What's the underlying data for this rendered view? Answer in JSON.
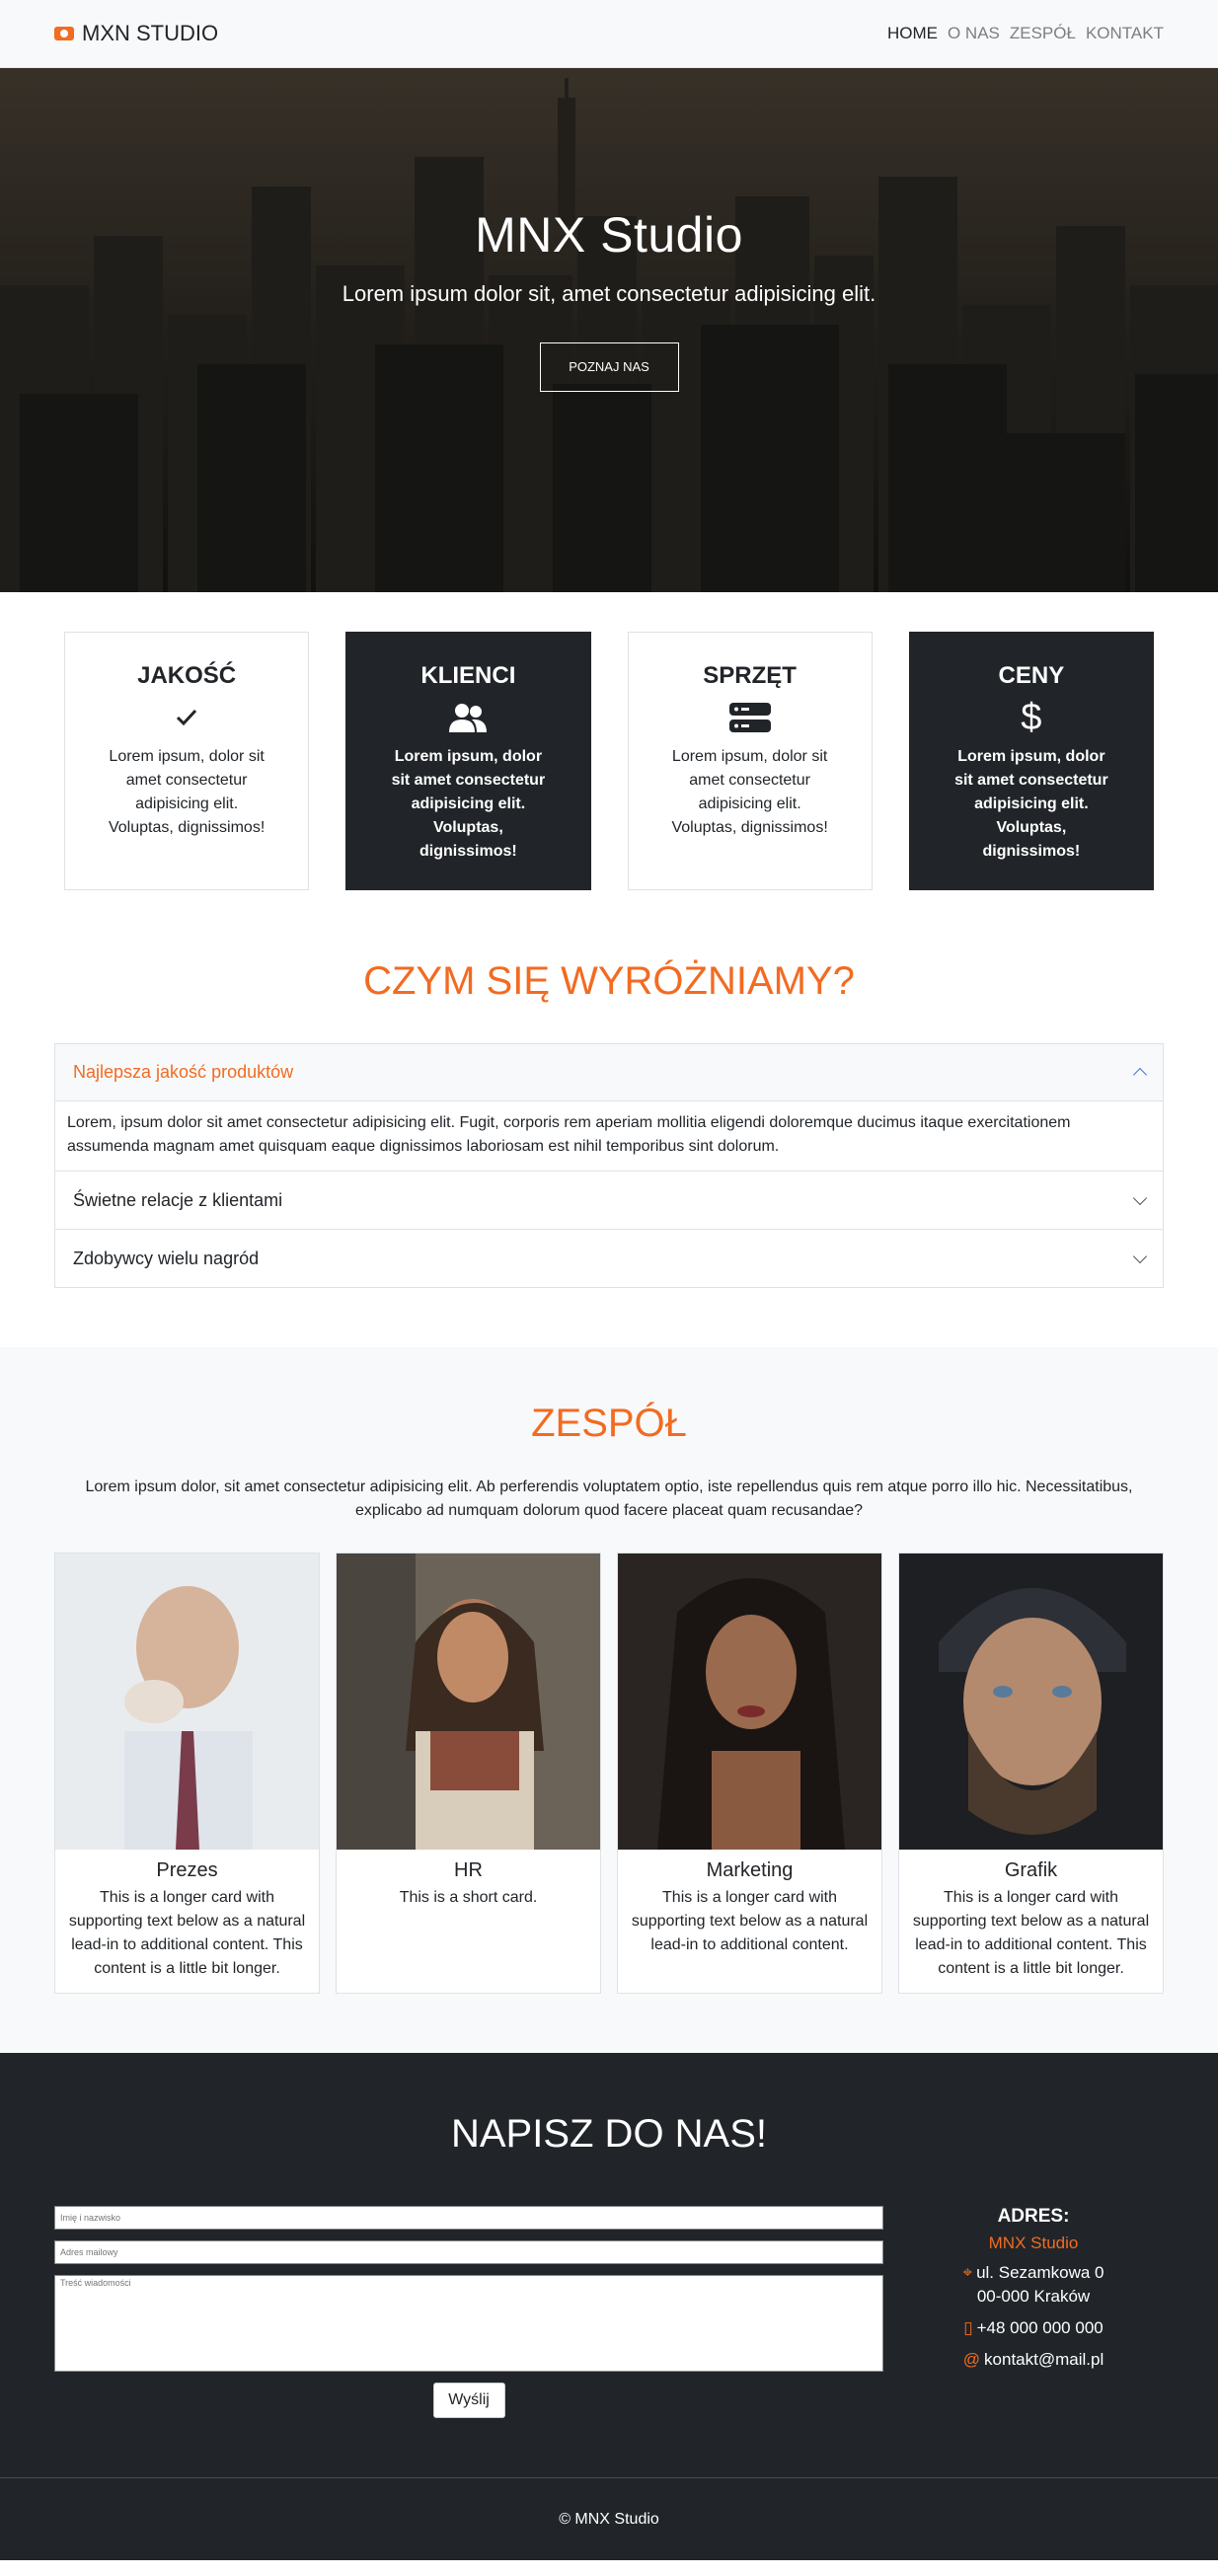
{
  "navbar": {
    "brand": "MXN STUDIO",
    "links": [
      "HOME",
      "O NAS",
      "ZESPÓŁ",
      "KONTAKT"
    ]
  },
  "hero": {
    "title": "MNX Studio",
    "subtitle": "Lorem ipsum dolor sit, amet consectetur adipisicing elit.",
    "button": "POZNAJ NAS"
  },
  "features": [
    {
      "title": "JAKOŚĆ",
      "icon": "check-icon",
      "text": "Lorem ipsum, dolor sit amet consectetur adipisicing elit. Voluptas, dignissimos!"
    },
    {
      "title": "KLIENCI",
      "icon": "users-icon",
      "text": "Lorem ipsum, dolor sit amet consectetur adipisicing elit. Voluptas, dignissimos!"
    },
    {
      "title": "SPRZĘT",
      "icon": "server-icon",
      "text": "Lorem ipsum, dolor sit amet consectetur adipisicing elit. Voluptas, dignissimos!"
    },
    {
      "title": "CENY",
      "icon": "dollar-icon",
      "text": "Lorem ipsum, dolor sit amet consectetur adipisicing elit. Voluptas, dignissimos!"
    }
  ],
  "why": {
    "title": "CZYM SIĘ WYRÓŻNIAMY?",
    "items": [
      {
        "heading": "Najlepsza jakość produktów",
        "body": "Lorem, ipsum dolor sit amet consectetur adipisicing elit. Fugit, corporis rem aperiam mollitia eligendi doloremque ducimus itaque exercitationem assumenda magnam amet quisquam eaque dignissimos laboriosam est nihil temporibus sint dolorum."
      },
      {
        "heading": "Świetne relacje z klientami"
      },
      {
        "heading": "Zdobywcy wielu nagród"
      }
    ]
  },
  "team": {
    "title": "ZESPÓŁ",
    "intro": "Lorem ipsum dolor, sit amet consectetur adipisicing elit. Ab perferendis voluptatem optio, iste repellendus quis rem atque porro illo hic. Necessitatibus, explicabo ad numquam dolorum quod facere placeat quam recusandae?",
    "members": [
      {
        "role": "Prezes",
        "text": "This is a longer card with supporting text below as a natural lead-in to additional content. This content is a little bit longer."
      },
      {
        "role": "HR",
        "text": "This is a short card."
      },
      {
        "role": "Marketing",
        "text": "This is a longer card with supporting text below as a natural lead-in to additional content."
      },
      {
        "role": "Grafik",
        "text": "This is a longer card with supporting text below as a natural lead-in to additional content. This content is a little bit longer."
      }
    ]
  },
  "contact": {
    "title": "NAPISZ DO NAS!",
    "name_placeholder": "Imię i nazwisko",
    "email_placeholder": "Adres mailowy",
    "message_placeholder": "Treść wiadomości",
    "send": "Wyślij",
    "address_title": "ADRES:",
    "company": "MNX Studio",
    "street": "ul. Sezamkowa 0",
    "city": "00-000 Kraków",
    "phone": "+48 000 000 000",
    "email": "kontakt@mail.pl"
  },
  "footer": {
    "text": "© MNX Studio"
  },
  "colors": {
    "accent": "#f26b21",
    "dark": "#212529",
    "light": "#f8f9fa"
  }
}
